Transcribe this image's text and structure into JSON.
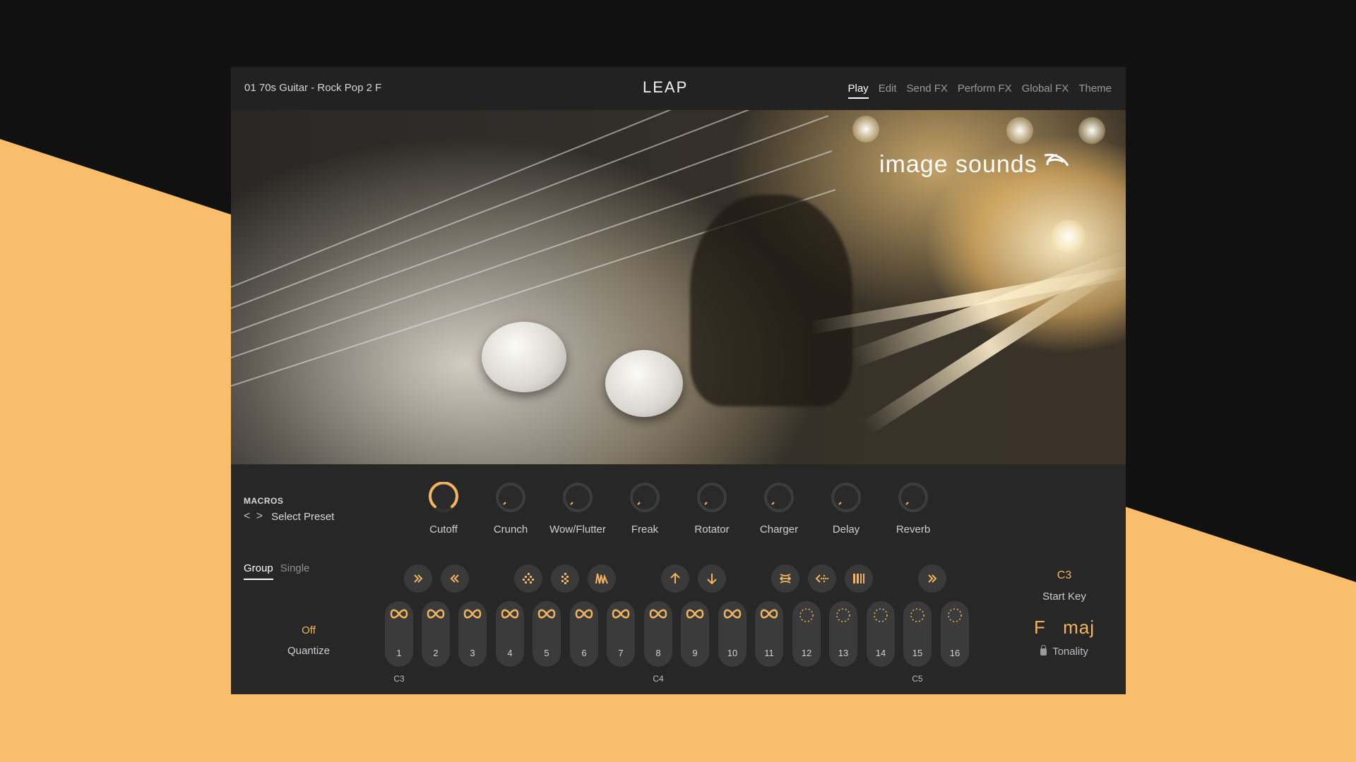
{
  "header": {
    "preset_name": "01 70s Guitar - Rock Pop 2 F",
    "logo": "LEAP",
    "tabs": [
      {
        "label": "Play",
        "active": true
      },
      {
        "label": "Edit"
      },
      {
        "label": "Send FX"
      },
      {
        "label": "Perform FX"
      },
      {
        "label": "Global FX"
      },
      {
        "label": "Theme"
      }
    ]
  },
  "hero": {
    "brand": "image sounds"
  },
  "macros": {
    "title": "MACROS",
    "select_label": "Select Preset",
    "knobs": [
      {
        "label": "Cutoff",
        "active": true
      },
      {
        "label": "Crunch"
      },
      {
        "label": "Wow/Flutter"
      },
      {
        "label": "Freak"
      },
      {
        "label": "Rotator"
      },
      {
        "label": "Charger"
      },
      {
        "label": "Delay"
      },
      {
        "label": "Reverb"
      }
    ]
  },
  "mode": {
    "group": "Group",
    "single": "Single"
  },
  "quantize": {
    "value": "Off",
    "label": "Quantize"
  },
  "actions": [
    {
      "name": "fast-forward-icon"
    },
    {
      "name": "rewind-icon"
    },
    {
      "name": "diamond-pattern-icon"
    },
    {
      "name": "diamond-pattern-2-icon"
    },
    {
      "name": "waveform-icon"
    },
    {
      "name": "arrow-up-icon"
    },
    {
      "name": "arrow-down-icon"
    },
    {
      "name": "swap-icon"
    },
    {
      "name": "dotted-arrow-icon"
    },
    {
      "name": "bars-icon"
    },
    {
      "name": "fast-forward-2-icon"
    }
  ],
  "pads": [
    {
      "num": "1",
      "icon": "infinity-icon"
    },
    {
      "num": "2",
      "icon": "infinity-icon"
    },
    {
      "num": "3",
      "icon": "infinity-icon"
    },
    {
      "num": "4",
      "icon": "infinity-icon"
    },
    {
      "num": "5",
      "icon": "infinity-icon"
    },
    {
      "num": "6",
      "icon": "infinity-icon"
    },
    {
      "num": "7",
      "icon": "infinity-icon"
    },
    {
      "num": "8",
      "icon": "infinity-icon"
    },
    {
      "num": "9",
      "icon": "infinity-icon"
    },
    {
      "num": "10",
      "icon": "infinity-icon"
    },
    {
      "num": "11",
      "icon": "infinity-icon"
    },
    {
      "num": "12",
      "icon": "dotted-circle-icon"
    },
    {
      "num": "13",
      "icon": "dotted-circle-icon"
    },
    {
      "num": "14",
      "icon": "dotted-circle-icon"
    },
    {
      "num": "15",
      "icon": "dotted-circle-icon"
    },
    {
      "num": "16",
      "icon": "dotted-circle-icon"
    }
  ],
  "note_labels": [
    "C3",
    "C4",
    "C5"
  ],
  "start_key": {
    "value": "C3",
    "label": "Start Key"
  },
  "tonality": {
    "root": "F",
    "scale": "maj",
    "label": "Tonality"
  },
  "colors": {
    "accent": "#f3b55e",
    "panel": "#272727",
    "background_peach": "#f8be6c",
    "background_dark": "#111111"
  }
}
